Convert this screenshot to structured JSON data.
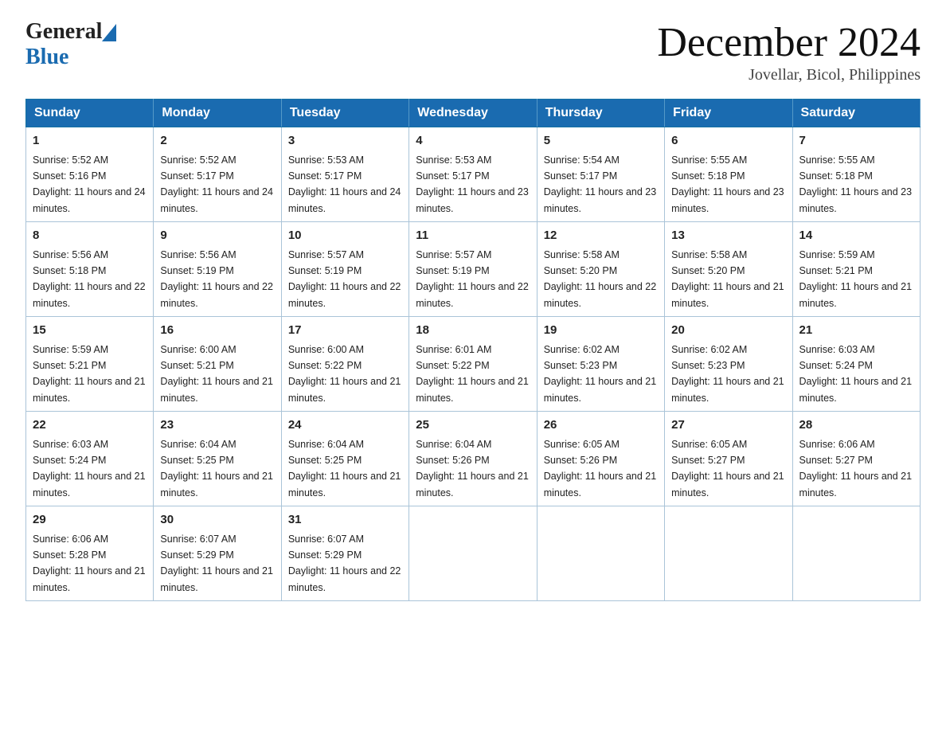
{
  "header": {
    "logo_general": "General",
    "logo_blue": "Blue",
    "title": "December 2024",
    "location": "Jovellar, Bicol, Philippines"
  },
  "days_of_week": [
    "Sunday",
    "Monday",
    "Tuesday",
    "Wednesday",
    "Thursday",
    "Friday",
    "Saturday"
  ],
  "weeks": [
    [
      {
        "day": "1",
        "sunrise": "5:52 AM",
        "sunset": "5:16 PM",
        "daylight": "11 hours and 24 minutes."
      },
      {
        "day": "2",
        "sunrise": "5:52 AM",
        "sunset": "5:17 PM",
        "daylight": "11 hours and 24 minutes."
      },
      {
        "day": "3",
        "sunrise": "5:53 AM",
        "sunset": "5:17 PM",
        "daylight": "11 hours and 24 minutes."
      },
      {
        "day": "4",
        "sunrise": "5:53 AM",
        "sunset": "5:17 PM",
        "daylight": "11 hours and 23 minutes."
      },
      {
        "day": "5",
        "sunrise": "5:54 AM",
        "sunset": "5:17 PM",
        "daylight": "11 hours and 23 minutes."
      },
      {
        "day": "6",
        "sunrise": "5:55 AM",
        "sunset": "5:18 PM",
        "daylight": "11 hours and 23 minutes."
      },
      {
        "day": "7",
        "sunrise": "5:55 AM",
        "sunset": "5:18 PM",
        "daylight": "11 hours and 23 minutes."
      }
    ],
    [
      {
        "day": "8",
        "sunrise": "5:56 AM",
        "sunset": "5:18 PM",
        "daylight": "11 hours and 22 minutes."
      },
      {
        "day": "9",
        "sunrise": "5:56 AM",
        "sunset": "5:19 PM",
        "daylight": "11 hours and 22 minutes."
      },
      {
        "day": "10",
        "sunrise": "5:57 AM",
        "sunset": "5:19 PM",
        "daylight": "11 hours and 22 minutes."
      },
      {
        "day": "11",
        "sunrise": "5:57 AM",
        "sunset": "5:19 PM",
        "daylight": "11 hours and 22 minutes."
      },
      {
        "day": "12",
        "sunrise": "5:58 AM",
        "sunset": "5:20 PM",
        "daylight": "11 hours and 22 minutes."
      },
      {
        "day": "13",
        "sunrise": "5:58 AM",
        "sunset": "5:20 PM",
        "daylight": "11 hours and 21 minutes."
      },
      {
        "day": "14",
        "sunrise": "5:59 AM",
        "sunset": "5:21 PM",
        "daylight": "11 hours and 21 minutes."
      }
    ],
    [
      {
        "day": "15",
        "sunrise": "5:59 AM",
        "sunset": "5:21 PM",
        "daylight": "11 hours and 21 minutes."
      },
      {
        "day": "16",
        "sunrise": "6:00 AM",
        "sunset": "5:21 PM",
        "daylight": "11 hours and 21 minutes."
      },
      {
        "day": "17",
        "sunrise": "6:00 AM",
        "sunset": "5:22 PM",
        "daylight": "11 hours and 21 minutes."
      },
      {
        "day": "18",
        "sunrise": "6:01 AM",
        "sunset": "5:22 PM",
        "daylight": "11 hours and 21 minutes."
      },
      {
        "day": "19",
        "sunrise": "6:02 AM",
        "sunset": "5:23 PM",
        "daylight": "11 hours and 21 minutes."
      },
      {
        "day": "20",
        "sunrise": "6:02 AM",
        "sunset": "5:23 PM",
        "daylight": "11 hours and 21 minutes."
      },
      {
        "day": "21",
        "sunrise": "6:03 AM",
        "sunset": "5:24 PM",
        "daylight": "11 hours and 21 minutes."
      }
    ],
    [
      {
        "day": "22",
        "sunrise": "6:03 AM",
        "sunset": "5:24 PM",
        "daylight": "11 hours and 21 minutes."
      },
      {
        "day": "23",
        "sunrise": "6:04 AM",
        "sunset": "5:25 PM",
        "daylight": "11 hours and 21 minutes."
      },
      {
        "day": "24",
        "sunrise": "6:04 AM",
        "sunset": "5:25 PM",
        "daylight": "11 hours and 21 minutes."
      },
      {
        "day": "25",
        "sunrise": "6:04 AM",
        "sunset": "5:26 PM",
        "daylight": "11 hours and 21 minutes."
      },
      {
        "day": "26",
        "sunrise": "6:05 AM",
        "sunset": "5:26 PM",
        "daylight": "11 hours and 21 minutes."
      },
      {
        "day": "27",
        "sunrise": "6:05 AM",
        "sunset": "5:27 PM",
        "daylight": "11 hours and 21 minutes."
      },
      {
        "day": "28",
        "sunrise": "6:06 AM",
        "sunset": "5:27 PM",
        "daylight": "11 hours and 21 minutes."
      }
    ],
    [
      {
        "day": "29",
        "sunrise": "6:06 AM",
        "sunset": "5:28 PM",
        "daylight": "11 hours and 21 minutes."
      },
      {
        "day": "30",
        "sunrise": "6:07 AM",
        "sunset": "5:29 PM",
        "daylight": "11 hours and 21 minutes."
      },
      {
        "day": "31",
        "sunrise": "6:07 AM",
        "sunset": "5:29 PM",
        "daylight": "11 hours and 22 minutes."
      },
      null,
      null,
      null,
      null
    ]
  ],
  "labels": {
    "sunrise": "Sunrise:",
    "sunset": "Sunset:",
    "daylight": "Daylight:"
  }
}
